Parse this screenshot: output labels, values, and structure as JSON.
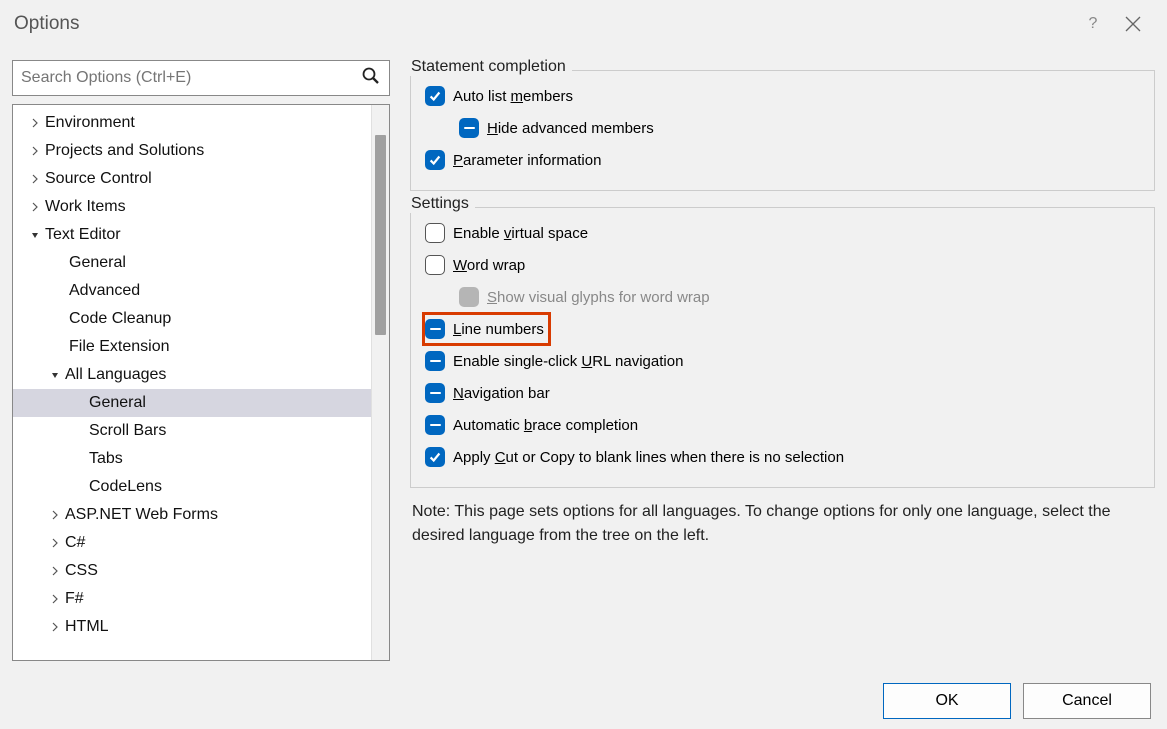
{
  "title": "Options",
  "search": {
    "placeholder": "Search Options (Ctrl+E)"
  },
  "tree": [
    {
      "label": "Environment",
      "depth": 0,
      "expand": "closed"
    },
    {
      "label": "Projects and Solutions",
      "depth": 0,
      "expand": "closed"
    },
    {
      "label": "Source Control",
      "depth": 0,
      "expand": "closed"
    },
    {
      "label": "Work Items",
      "depth": 0,
      "expand": "closed"
    },
    {
      "label": "Text Editor",
      "depth": 0,
      "expand": "open"
    },
    {
      "label": "General",
      "depth": 1,
      "expand": "none"
    },
    {
      "label": "Advanced",
      "depth": 1,
      "expand": "none"
    },
    {
      "label": "Code Cleanup",
      "depth": 1,
      "expand": "none"
    },
    {
      "label": "File Extension",
      "depth": 1,
      "expand": "none"
    },
    {
      "label": "All Languages",
      "depth": 1,
      "expand": "open"
    },
    {
      "label": "General",
      "depth": 2,
      "expand": "none",
      "selected": true
    },
    {
      "label": "Scroll Bars",
      "depth": 2,
      "expand": "none"
    },
    {
      "label": "Tabs",
      "depth": 2,
      "expand": "none"
    },
    {
      "label": "CodeLens",
      "depth": 2,
      "expand": "none"
    },
    {
      "label": "ASP.NET Web Forms",
      "depth": 1,
      "expand": "closed"
    },
    {
      "label": "C#",
      "depth": 1,
      "expand": "closed"
    },
    {
      "label": "CSS",
      "depth": 1,
      "expand": "closed"
    },
    {
      "label": "F#",
      "depth": 1,
      "expand": "closed"
    },
    {
      "label": "HTML",
      "depth": 1,
      "expand": "closed"
    }
  ],
  "groups": {
    "statement": {
      "title": "Statement completion",
      "auto_list": {
        "pre": "Auto list ",
        "u": "m",
        "post": "embers",
        "state": "checked"
      },
      "hide_adv": {
        "pre": "",
        "u": "H",
        "post": "ide advanced members",
        "state": "indet",
        "indent": 1
      },
      "param_info": {
        "pre": "",
        "u": "P",
        "post": "arameter information",
        "state": "checked"
      }
    },
    "settings": {
      "title": "Settings",
      "virtual_space": {
        "pre": "Enable ",
        "u": "v",
        "post": "irtual space",
        "state": "unchecked"
      },
      "word_wrap": {
        "pre": "",
        "u": "W",
        "post": "ord wrap",
        "state": "unchecked"
      },
      "glyphs": {
        "pre": "",
        "u": "S",
        "post": "how visual glyphs for word wrap",
        "state": "disabled",
        "indent": 1
      },
      "line_numbers": {
        "pre": "",
        "u": "L",
        "post": "ine numbers",
        "state": "indet",
        "highlight": true
      },
      "url_nav": {
        "pre": "Enable single-click ",
        "u": "U",
        "post": "RL navigation",
        "state": "indet"
      },
      "nav_bar": {
        "pre": "",
        "u": "N",
        "post": "avigation bar",
        "state": "indet"
      },
      "brace": {
        "pre": "Automatic ",
        "u": "b",
        "post": "race completion",
        "state": "indet"
      },
      "cut_copy": {
        "pre": "Apply ",
        "u": "C",
        "post": "ut or Copy to blank lines when there is no selection",
        "state": "checked"
      }
    }
  },
  "note": "Note: This page sets options for all languages. To change options for only one language, select the desired language from the tree on the left.",
  "buttons": {
    "ok": "OK",
    "cancel": "Cancel"
  }
}
